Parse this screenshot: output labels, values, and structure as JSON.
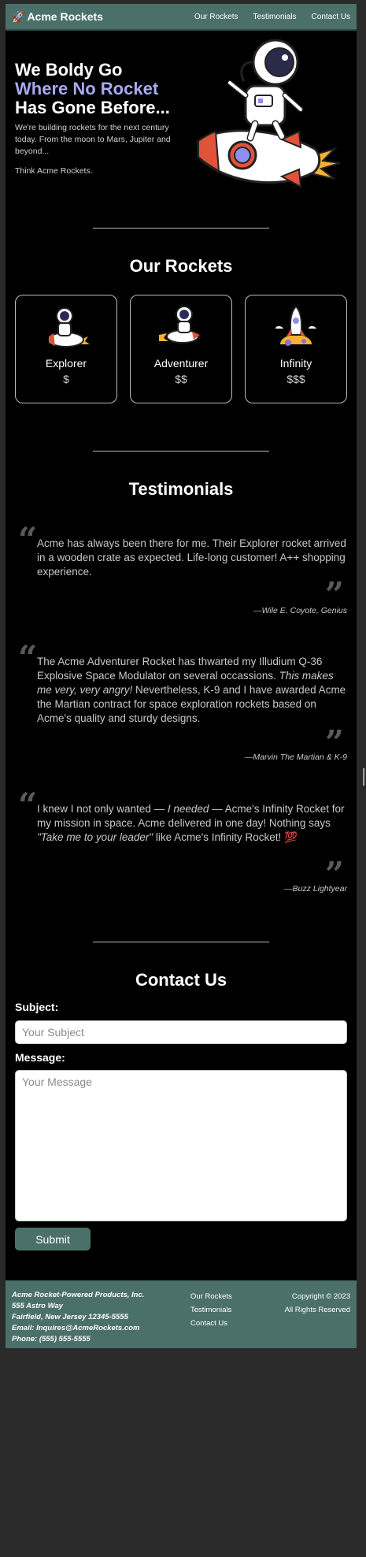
{
  "nav": {
    "brand": "Acme Rockets",
    "links": [
      "Our Rockets",
      "Testimonials",
      "Contact Us"
    ]
  },
  "hero": {
    "line1": "We Boldy Go",
    "line2": "Where No Rocket",
    "line3": "Has Gone Before...",
    "description": "We're building rockets for the next century today. From the moon to Mars, Jupiter and beyond...",
    "tagline": "Think Acme Rockets."
  },
  "rockets": {
    "title": "Our Rockets",
    "items": [
      {
        "name": "Explorer",
        "price": "$"
      },
      {
        "name": "Adventurer",
        "price": "$$"
      },
      {
        "name": "Infinity",
        "price": "$$$"
      }
    ]
  },
  "testimonials": {
    "title": "Testimonials",
    "items": [
      {
        "text": "Acme has always been there for me. Their Explorer rocket arrived in a wooden crate as expected. Life-long customer! A++ shopping experience.",
        "author": "—Wile E. Coyote, Genius"
      },
      {
        "text_part1": "The Acme Adventurer Rocket has thwarted my Illudium Q-36 Explosive Space Modulator on several occassions. ",
        "text_em": "This makes me very, very angry!",
        "text_part2": " Nevertheless, K-9 and I have awarded Acme the Martian contract for space exploration rockets based on Acme's quality and sturdy designs.",
        "author": "—Marvin The Martian & K-9"
      },
      {
        "text_part1": "I knew I not only wanted — ",
        "text_em1": "I needed",
        "text_part2": " — Acme's Infinity Rocket for my mission in space. Acme delivered in one day! Nothing says ",
        "text_em2": "\"Take me to your leader\"",
        "text_part3": " like Acme's Infinity Rocket! 💯",
        "author": "—Buzz Lightyear"
      }
    ]
  },
  "contact": {
    "title": "Contact Us",
    "subject_label": "Subject:",
    "subject_placeholder": "Your Subject",
    "message_label": "Message:",
    "message_placeholder": "Your Message",
    "submit_label": "Submit"
  },
  "footer": {
    "address": [
      "Acme Rocket-Powered Products, Inc.",
      "555 Astro Way",
      "Fairfield, New Jersey 12345-5555",
      "Email: Inquires@AcmeRockets.com",
      "Phone: (555) 555-5555"
    ],
    "links": [
      "Our Rockets",
      "Testimonials",
      "Contact Us"
    ],
    "copyright": "Copyright © 2023",
    "rights": "All Rights Reserved"
  },
  "colors": {
    "nav_bg": "#4b706a",
    "accent_text": "#a8aaf0",
    "page_bg": "#000000"
  }
}
